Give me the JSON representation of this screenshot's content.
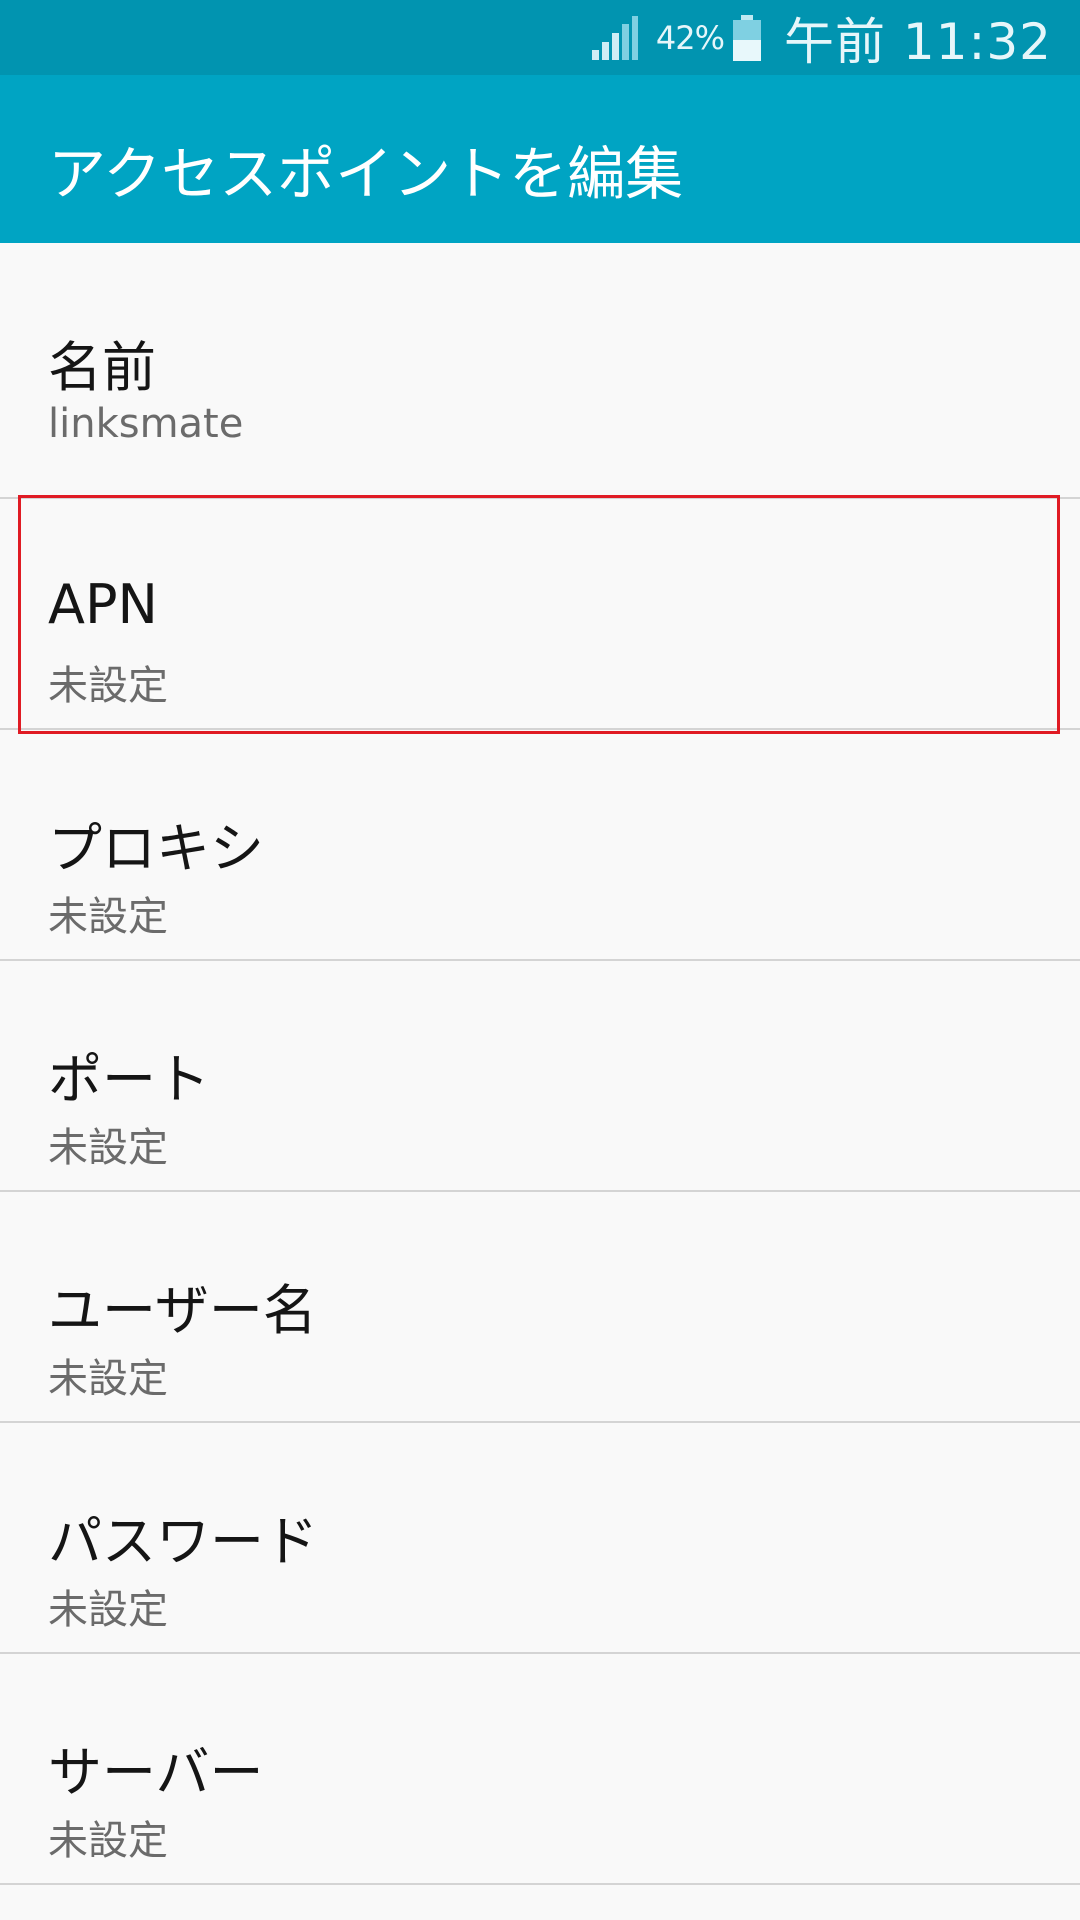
{
  "status_bar": {
    "battery_percent": "42%",
    "time": "午前 11:32",
    "signal_icon": "cell-signal-icon",
    "battery_icon": "battery-icon"
  },
  "app_bar": {
    "title": "アクセスポイントを編集"
  },
  "settings": [
    {
      "title": "名前",
      "value": "linksmate"
    },
    {
      "title": "APN",
      "value": "未設定"
    },
    {
      "title": "プロキシ",
      "value": "未設定"
    },
    {
      "title": "ポート",
      "value": "未設定"
    },
    {
      "title": "ユーザー名",
      "value": "未設定"
    },
    {
      "title": "パスワード",
      "value": "未設定"
    },
    {
      "title": "サーバー",
      "value": "未設定"
    }
  ],
  "colors": {
    "status_bar": "#0194b0",
    "app_bar": "#00a4c3",
    "highlight": "#e01b24",
    "background": "#f9f9f9"
  }
}
